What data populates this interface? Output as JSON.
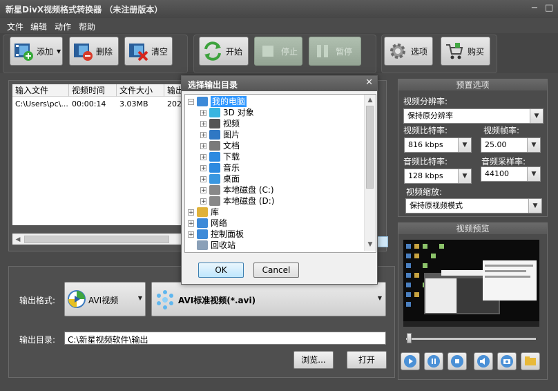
{
  "window": {
    "title": "新星DivX视频格式转换器 （未注册版本）",
    "controls": [
      "−",
      "□",
      "✕"
    ]
  },
  "menu": [
    "文件",
    "编辑",
    "动作",
    "帮助"
  ],
  "toolbar": {
    "add": "添加",
    "delete": "删除",
    "clear": "清空",
    "start": "开始",
    "stop": "停止",
    "pause": "暂停",
    "options": "选项",
    "buy": "购买"
  },
  "filelist": {
    "columns": [
      "输入文件",
      "视频时间",
      "文件大小",
      "输出"
    ],
    "rows": [
      [
        "C:\\Users\\pc\\...",
        "00:00:14",
        "3.03MB",
        "202"
      ]
    ]
  },
  "output": {
    "format_label": "输出格式:",
    "format_value": "AVI视频",
    "profile_value": "AVI标准视频(*.avi)",
    "dir_label": "输出目录:",
    "dir_value": "C:\\新星视频软件\\输出",
    "browse": "浏览...",
    "open": "打开"
  },
  "presets": {
    "header": "预置选项",
    "resolution_label": "视频分辨率:",
    "resolution_value": "保持原分辨率",
    "video_bitrate_label": "视频比特率:",
    "video_bitrate_value": "816 kbps",
    "framerate_label": "视频帧率:",
    "framerate_value": "25.00",
    "audio_bitrate_label": "音频比特率:",
    "audio_bitrate_value": "128 kbps",
    "samplerate_label": "音频采样率:",
    "samplerate_value": "44100",
    "scale_label": "视频缩放:",
    "scale_value": "保持原视频模式"
  },
  "preview": {
    "header": "视频预览"
  },
  "dialog": {
    "title": "选择输出目录",
    "close": "✕",
    "tree": [
      {
        "label": "我的电脑",
        "level": 0,
        "expanded": true,
        "selected": true,
        "icon": "computer-icon"
      },
      {
        "label": "3D 对象",
        "level": 1,
        "icon": "3d-objects-icon"
      },
      {
        "label": "视频",
        "level": 1,
        "icon": "videos-icon"
      },
      {
        "label": "图片",
        "level": 1,
        "icon": "pictures-icon"
      },
      {
        "label": "文档",
        "level": 1,
        "icon": "documents-icon"
      },
      {
        "label": "下载",
        "level": 1,
        "icon": "downloads-icon"
      },
      {
        "label": "音乐",
        "level": 1,
        "icon": "music-icon"
      },
      {
        "label": "桌面",
        "level": 1,
        "icon": "desktop-icon"
      },
      {
        "label": "本地磁盘 (C:)",
        "level": 1,
        "icon": "drive-icon"
      },
      {
        "label": "本地磁盘 (D:)",
        "level": 1,
        "icon": "drive-icon"
      },
      {
        "label": "库",
        "level": 0,
        "icon": "library-icon"
      },
      {
        "label": "网络",
        "level": 0,
        "icon": "network-icon"
      },
      {
        "label": "控制面板",
        "level": 0,
        "icon": "control-panel-icon"
      },
      {
        "label": "回收站",
        "level": 0,
        "icon": "recycle-bin-icon",
        "noexpander": true
      }
    ],
    "ok": "OK",
    "cancel": "Cancel"
  }
}
